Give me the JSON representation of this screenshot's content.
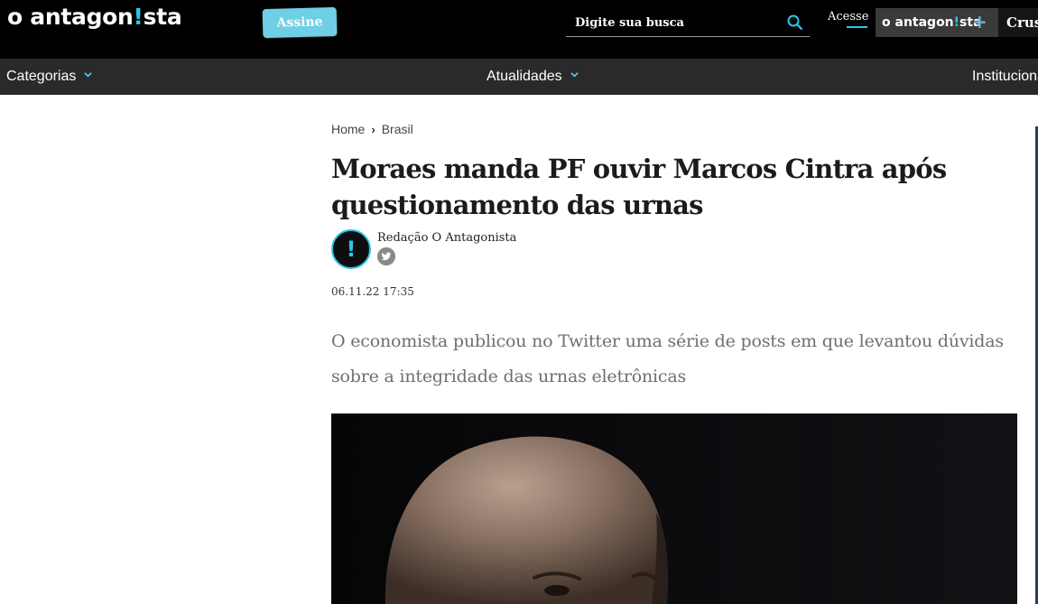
{
  "header": {
    "logo_text_a": "o antagon",
    "logo_bang": "!",
    "logo_text_b": "sta",
    "subscribe_label": "Assine",
    "search_placeholder": "Digite sua busca",
    "login_label": "Acesse",
    "plus_brand_a": "o antagon",
    "plus_brand_bang": "!",
    "plus_brand_b": "sta",
    "partner_label": "Crusoé"
  },
  "nav": {
    "categories_label": "Categorias",
    "updates_label": "Atualidades",
    "institutional_label": "Institucional"
  },
  "breadcrumb": {
    "home": "Home",
    "section": "Brasil"
  },
  "article": {
    "headline": "Moraes manda PF ouvir Marcos Cintra após questionamento das urnas",
    "author": "Redação O Antagonista",
    "avatar_mark": "!",
    "date": "06.11.22 17:35",
    "lead": "O economista publicou no Twitter uma série de posts em que levantou dúvidas sobre a integridade das urnas eletrônicas"
  },
  "icons": {
    "search": "search-icon",
    "chevron": "chevron-down-icon",
    "twitter": "twitter-icon",
    "plus": "plus-icon"
  },
  "colors": {
    "accent": "#2bc6e8",
    "topbar": "#000000",
    "navbar": "#2a2a2a",
    "subscribe_bg": "#6fcfe4"
  }
}
